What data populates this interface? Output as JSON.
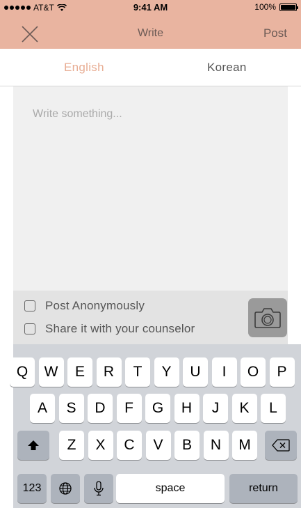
{
  "status_bar": {
    "carrier": "AT&T",
    "time": "9:41 AM",
    "battery": "100%",
    "battery_level": 1.0
  },
  "nav": {
    "title": "Write",
    "post_label": "Post"
  },
  "tabs": [
    {
      "label": "English",
      "active": true
    },
    {
      "label": "Korean",
      "active": false
    }
  ],
  "compose": {
    "placeholder": "Write something..."
  },
  "options": {
    "anonymous_label": "Post Anonymously",
    "anonymous_checked": false,
    "counselor_label": "Share it with your counselor",
    "counselor_checked": false
  },
  "keyboard": {
    "row1": [
      "Q",
      "W",
      "E",
      "R",
      "T",
      "Y",
      "U",
      "I",
      "O",
      "P"
    ],
    "row2": [
      "A",
      "S",
      "D",
      "F",
      "G",
      "H",
      "J",
      "K",
      "L"
    ],
    "row3": [
      "Z",
      "X",
      "C",
      "V",
      "B",
      "N",
      "M"
    ],
    "numbers_label": "123",
    "space_label": "space",
    "return_label": "return"
  },
  "colors": {
    "accent": "#e9b4a0",
    "active_tab": "#e8ad93",
    "keyboard_bg": "#d1d4d9"
  }
}
